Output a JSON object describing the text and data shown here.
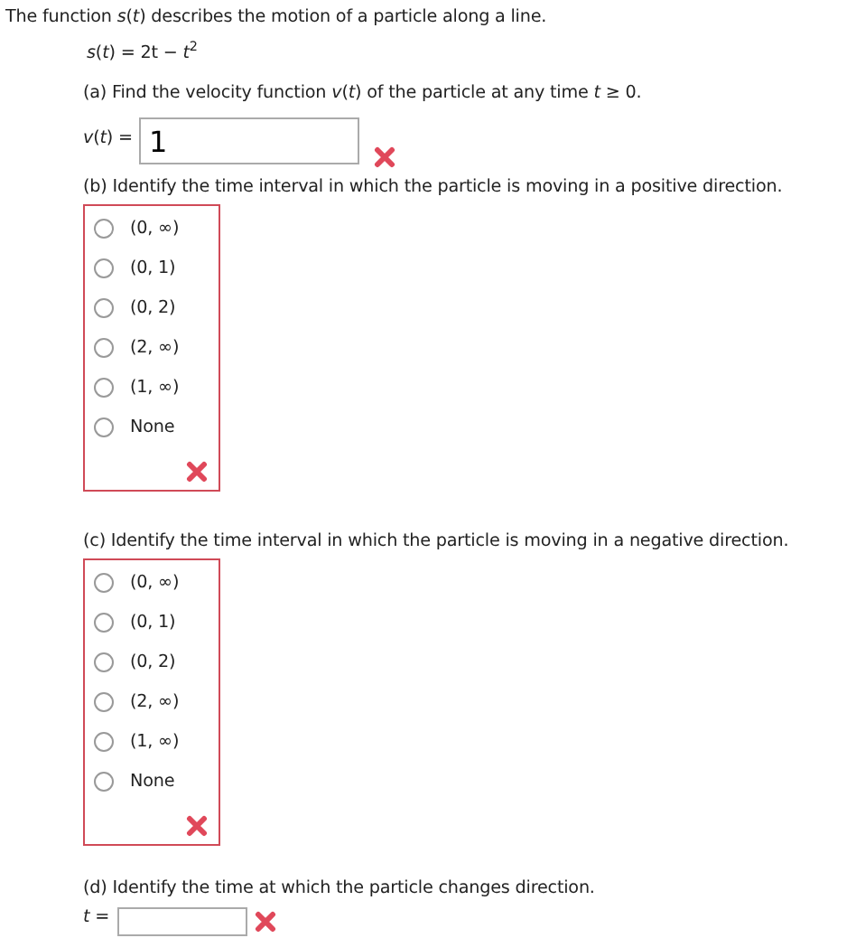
{
  "intro": "The function *s*(*t*) describes the motion of a particle along a line.",
  "equation": "*s*(*t*) = 2t − *t*$^{2}$",
  "parts": [
    {
      "kind": "field",
      "prompt": "(a) Find the velocity function *v*(*t*) of the particle at any time *t* ≥ 0.",
      "label": "*v*(*t*) =",
      "value": "1",
      "correct": false
    },
    {
      "kind": "choice",
      "prompt": "(b) Identify the time interval in which the particle is moving in a positive direction.",
      "correct": false,
      "options": [
        {
          "label": "(0, ∞)",
          "selected": false
        },
        {
          "label": "(0, 1)",
          "selected": false
        },
        {
          "label": "(0, 2)",
          "selected": false
        },
        {
          "label": "(2, ∞)",
          "selected": false
        },
        {
          "label": "(1, ∞)",
          "selected": false
        },
        {
          "label": "None",
          "selected": false
        }
      ]
    },
    {
      "kind": "choice",
      "prompt": "(c) Identify the time interval in which the particle is moving in a negative direction.",
      "correct": false,
      "options": [
        {
          "label": "(0, ∞)",
          "selected": false
        },
        {
          "label": "(0, 1)",
          "selected": false
        },
        {
          "label": "(0, 2)",
          "selected": false
        },
        {
          "label": "(2, ∞)",
          "selected": false
        },
        {
          "label": "(1, ∞)",
          "selected": false
        },
        {
          "label": "None",
          "selected": false
        }
      ]
    },
    {
      "kind": "inline",
      "prompt": "(d) Identify the time at which the particle changes direction.",
      "label": "*t* =",
      "correct": false
    }
  ]
}
